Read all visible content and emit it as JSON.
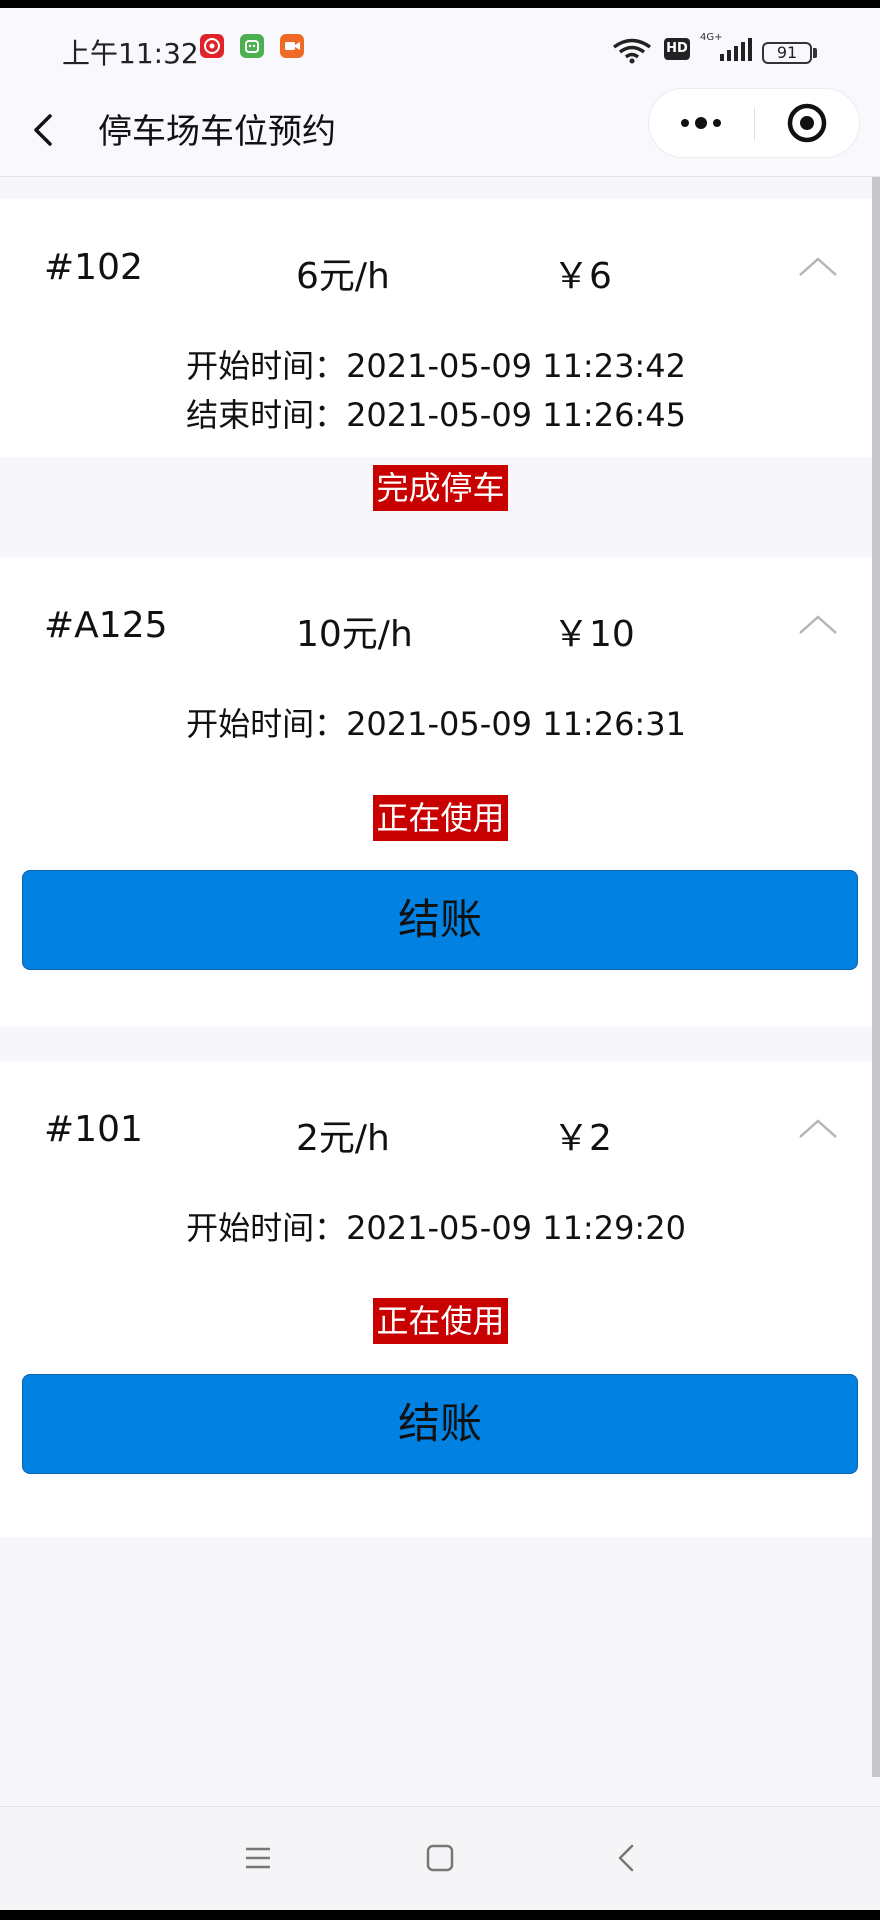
{
  "status_bar": {
    "time": "上午11:32",
    "network_type": "4G+",
    "hd_label": "HD",
    "battery_level": "91"
  },
  "header": {
    "title": "停车场车位预约"
  },
  "reservations": [
    {
      "spot": "#102",
      "rate": "6元/h",
      "price": "￥6",
      "start_time": "开始时间：2021-05-09 11:23:42",
      "end_time": "结束时间：2021-05-09 11:26:45",
      "status": "完成停车"
    },
    {
      "spot": "#A125",
      "rate": "10元/h",
      "price": "￥10",
      "start_time": "开始时间：2021-05-09 11:26:31",
      "status": "正在使用",
      "checkout_label": "结账"
    },
    {
      "spot": "#101",
      "rate": "2元/h",
      "price": "￥2",
      "start_time": "开始时间：2021-05-09 11:29:20",
      "status": "正在使用",
      "checkout_label": "结账"
    }
  ],
  "colors": {
    "status_badge": "#c80000",
    "checkout_button": "#0181e2",
    "page_background": "#f7f6fb"
  },
  "icons": {
    "back": "chevron-left-icon",
    "more": "more-dots-icon",
    "close": "target-circle-icon",
    "expand": "chevron-up-icon",
    "nav_menu": "menu-lines-icon",
    "nav_home": "square-icon",
    "nav_back": "chevron-left-icon"
  }
}
